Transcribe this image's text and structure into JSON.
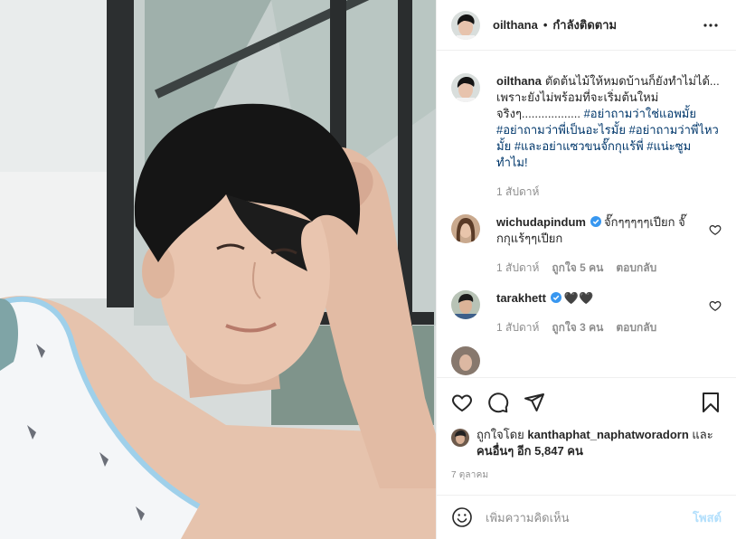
{
  "header": {
    "username": "oilthana",
    "separator": "•",
    "follow_status": "กำลังติดตาม"
  },
  "caption": {
    "username": "oilthana",
    "text_main": "ตัดต้นไม้ให้หมดบ้านก็ยังทำไม่ได้... เพราะยังไม่พร้อมที่จะเริ่มต้นใหม่ จริงๆ..................",
    "hashtags": [
      "#อย่าถามว่าใช่แอพมั้ย",
      "#อย่าถามว่าพี่เป็นอะไรมั้ย",
      "#อย่าถามว่าพี่ไหวมั้ย",
      "#และอย่าแซวขนจั๊กกุแร้พี่",
      "#แน่ะซูมทำไม!"
    ],
    "time": "1 สัปดาห์"
  },
  "comments": [
    {
      "username": "wichudapindum",
      "verified": true,
      "text": "จั๊กๆๆๆๆๆเปียก จั๊กกุแร้ๆๆเปียก",
      "time": "1 สัปดาห์",
      "likes": "ถูกใจ 5 คน",
      "reply": "ตอบกลับ"
    },
    {
      "username": "tarakhett",
      "verified": true,
      "text": "🖤🖤",
      "time": "1 สัปดาห์",
      "likes": "ถูกใจ 3 คน",
      "reply": "ตอบกลับ"
    }
  ],
  "likes_line": {
    "prefix": "ถูกใจโดย",
    "liker": "kanthaphat_naphatworadorn",
    "and": "และ",
    "others": "คนอื่นๆ อีก 5,847 คน"
  },
  "date": "7 ตุลาคม",
  "add_comment": {
    "placeholder": "เพิ่มความคิดเห็น",
    "post_label": "โพสต์"
  },
  "colors": {
    "link": "#00376b",
    "verified": "#3897f0",
    "muted": "#8e8e8e",
    "post_disabled": "#b2dffc"
  }
}
